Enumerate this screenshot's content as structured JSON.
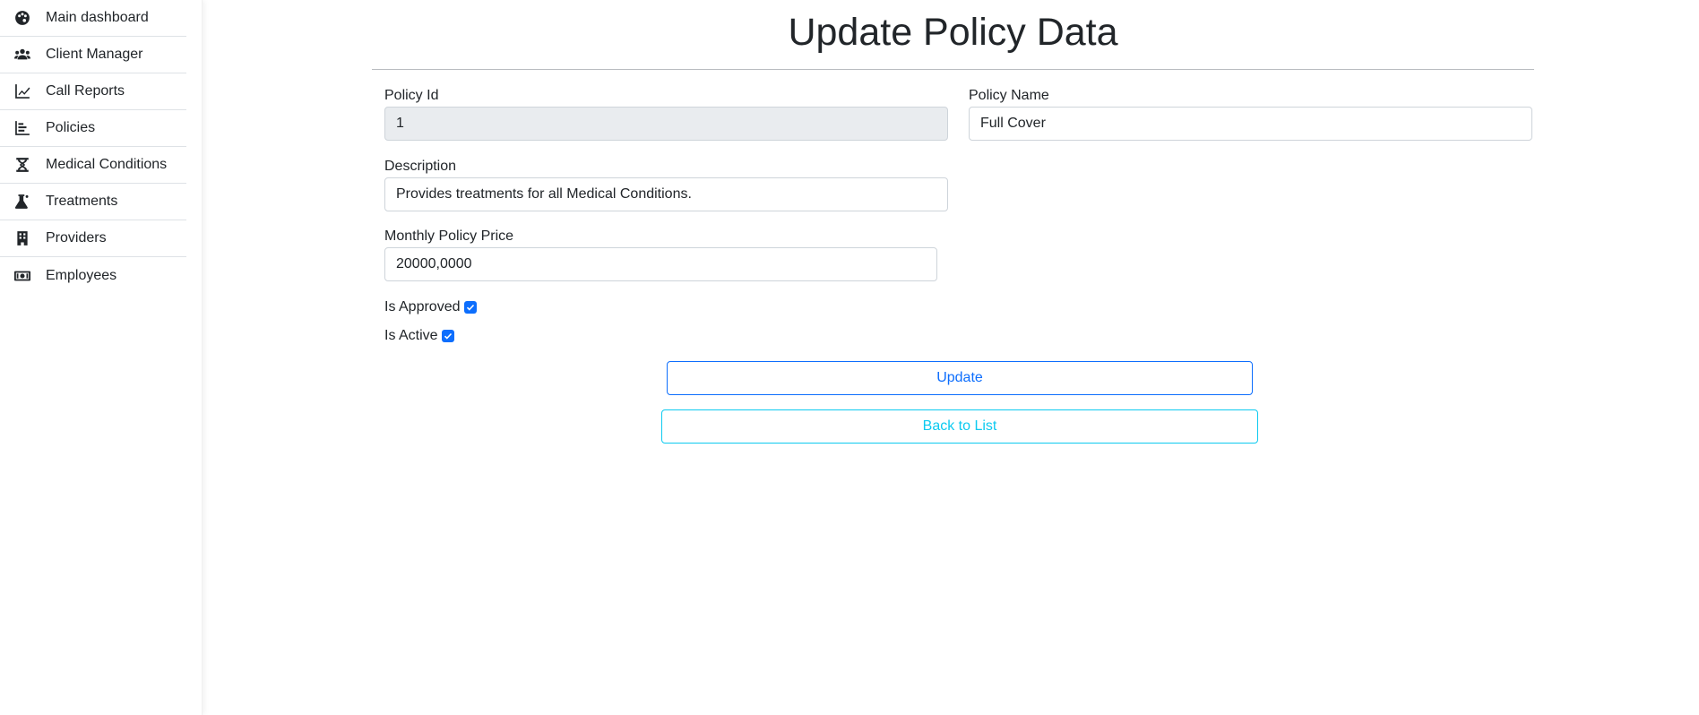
{
  "sidebar": {
    "items": [
      {
        "label": "Main dashboard",
        "icon": "palette-icon"
      },
      {
        "label": "Client Manager",
        "icon": "users-icon"
      },
      {
        "label": "Call Reports",
        "icon": "line-chart-icon"
      },
      {
        "label": "Policies",
        "icon": "bar-list-icon"
      },
      {
        "label": "Medical Conditions",
        "icon": "dna-icon"
      },
      {
        "label": "Treatments",
        "icon": "flask-icon"
      },
      {
        "label": "Providers",
        "icon": "building-icon"
      },
      {
        "label": "Employees",
        "icon": "money-bill-icon"
      }
    ]
  },
  "form": {
    "title": "Update Policy Data",
    "policy_id": {
      "label": "Policy Id",
      "value": "1"
    },
    "policy_name": {
      "label": "Policy Name",
      "value": "Full Cover"
    },
    "description": {
      "label": "Description",
      "value": "Provides treatments for all Medical Conditions."
    },
    "monthly_price": {
      "label": "Monthly Policy Price",
      "value": "20000,0000"
    },
    "is_approved": {
      "label": "Is Approved",
      "checked": true
    },
    "is_active": {
      "label": "Is Active",
      "checked": true
    },
    "update_label": "Update",
    "back_label": "Back to List"
  },
  "colors": {
    "primary": "#0d6efd",
    "info": "#0dcaf0",
    "readonly_bg": "#e9ecef",
    "text": "#212529"
  }
}
